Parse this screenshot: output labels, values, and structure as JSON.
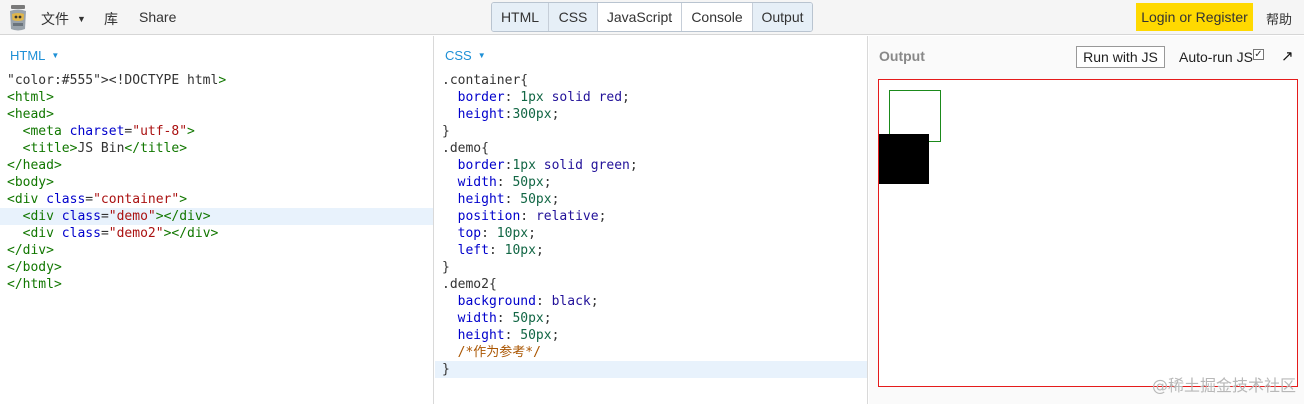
{
  "topbar": {
    "menu_file": "文件",
    "menu_lib": "库",
    "menu_share": "Share",
    "panel_tabs": [
      {
        "label": "HTML",
        "active": true
      },
      {
        "label": "CSS",
        "active": true
      },
      {
        "label": "JavaScript",
        "active": false
      },
      {
        "label": "Console",
        "active": false
      },
      {
        "label": "Output",
        "active": true
      }
    ],
    "login_label": "Login or Register",
    "help_label": "帮助"
  },
  "html_panel": {
    "label": "HTML",
    "lines": [
      "<!DOCTYPE html>",
      "<html>",
      "<head>",
      "  <meta charset=\"utf-8\">",
      "  <title>JS Bin</title>",
      "</head>",
      "<body>",
      "<div class=\"container\">",
      "  <div class=\"demo\"></div>",
      "  <div class=\"demo2\"></div>",
      "</div>",
      "</body>",
      "</html>"
    ],
    "highlighted_line": 8
  },
  "css_panel": {
    "label": "CSS",
    "lines": [
      ".container{",
      "  border: 1px solid red;",
      "  height:300px;",
      "}",
      ".demo{",
      "  border:1px solid green;",
      "  width: 50px;",
      "  height: 50px;",
      "  position: relative;",
      "  top: 10px;",
      "  left: 10px;",
      "}",
      ".demo2{",
      "  background: black;",
      "  width: 50px;",
      "  height: 50px;",
      "  /*作为参考*/",
      "}"
    ],
    "highlighted_line": 17
  },
  "output_panel": {
    "label": "Output",
    "run_label": "Run with JS",
    "autorun_label": "Auto-run JS",
    "autorun_checked": "✓",
    "popout_icon": "↗"
  },
  "colors": {
    "container_border": "#e51b1b",
    "demo_border": "#1b8a1b",
    "demo2_bg": "#000000",
    "login_bg": "#ffd900",
    "accent": "#1e90d6"
  },
  "watermark": "@稀土掘金技术社区"
}
